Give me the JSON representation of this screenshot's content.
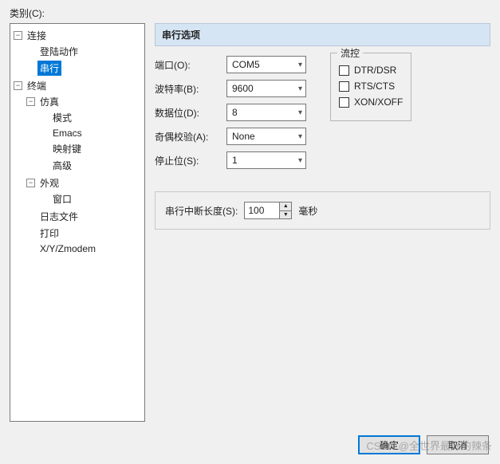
{
  "category_label": "类别(C):",
  "tree": {
    "connection": {
      "label": "连接",
      "children": {
        "login_actions": "登陆动作",
        "serial": "串行"
      }
    },
    "terminal": {
      "label": "终端",
      "children": {
        "emulation": {
          "label": "仿真",
          "children": {
            "mode": "模式",
            "emacs": "Emacs",
            "mapped_keys": "映射键",
            "advanced": "高级"
          }
        },
        "appearance": {
          "label": "外观",
          "children": {
            "window": "窗口"
          }
        },
        "log_file": "日志文件",
        "print": "打印",
        "xyz": "X/Y/Zmodem"
      }
    }
  },
  "panel_title": "串行选项",
  "fields": {
    "port": {
      "label": "端口(O):",
      "value": "COM5"
    },
    "baud": {
      "label": "波特率(B):",
      "value": "9600"
    },
    "data_bits": {
      "label": "数据位(D):",
      "value": "8"
    },
    "parity": {
      "label": "奇偶校验(A):",
      "value": "None"
    },
    "stop_bits": {
      "label": "停止位(S):",
      "value": "1"
    }
  },
  "flow_control": {
    "legend": "流控",
    "dtr_dsr": "DTR/DSR",
    "rts_cts": "RTS/CTS",
    "xon_xoff": "XON/XOFF"
  },
  "break_section": {
    "label": "串行中断长度(S):",
    "value": "100",
    "unit": "毫秒"
  },
  "buttons": {
    "ok": "确定",
    "cancel": "取消"
  },
  "watermark": "CSDN @全世界最好的辣条"
}
